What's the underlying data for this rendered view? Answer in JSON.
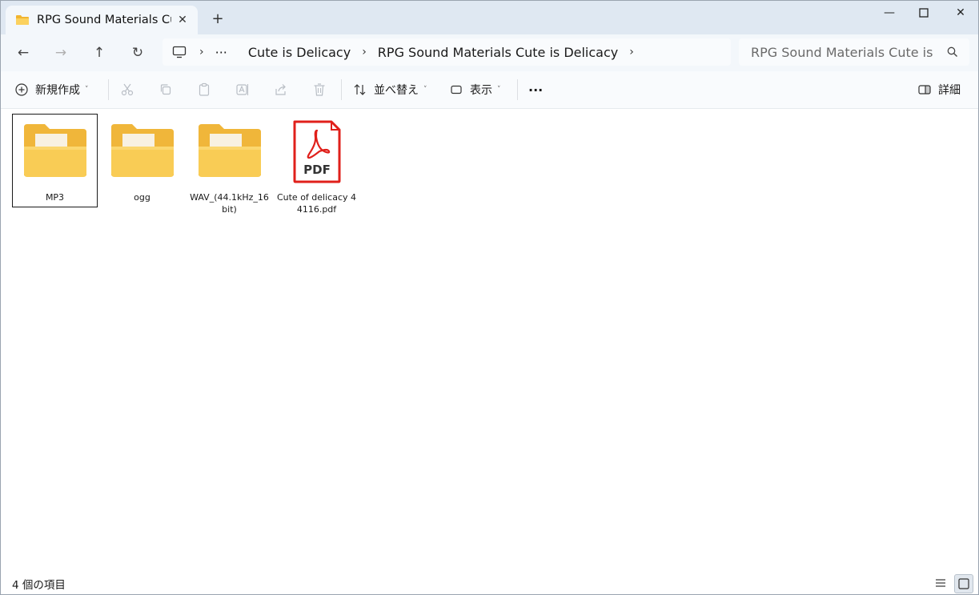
{
  "tab": {
    "title": "RPG Sound Materials Cute is Delicacy",
    "close": "✕",
    "new": "+"
  },
  "window_controls": {
    "minimize": "—",
    "maximize": "☐",
    "close": "✕"
  },
  "nav": {
    "back": "←",
    "forward": "→",
    "up": "↑",
    "refresh": "↻"
  },
  "address": {
    "ellipsis": "···",
    "crumbs": [
      "Cute is Delicacy",
      "RPG Sound Materials Cute is Delicacy"
    ],
    "sep": "›"
  },
  "search": {
    "placeholder": "RPG Sound Materials Cute is Delicacy"
  },
  "toolbar": {
    "new_label": "新規作成",
    "sort_label": "並べ替え",
    "view_label": "表示",
    "more_label": "···",
    "details_label": "詳細",
    "caret": "˅"
  },
  "items": [
    {
      "name": "MP3",
      "type": "folder",
      "selected": true
    },
    {
      "name": "ogg",
      "type": "folder",
      "selected": false
    },
    {
      "name": "WAV_(44.1kHz_16bit)",
      "type": "folder",
      "selected": false
    },
    {
      "name": "Cute of delicacy 44116.pdf",
      "type": "pdf",
      "selected": false,
      "badge": "PDF"
    }
  ],
  "status": {
    "count_text": "4 個の項目"
  },
  "colors": {
    "titlebar": "#dfe8f2",
    "folder": "#f6c443",
    "pdf_red": "#e0201b"
  }
}
